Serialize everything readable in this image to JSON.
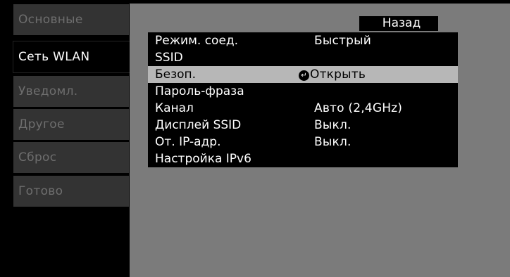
{
  "sidebar": {
    "items": [
      {
        "label": "Основные"
      },
      {
        "label": "Сеть WLAN"
      },
      {
        "label": "Уведомл."
      },
      {
        "label": "Другое"
      },
      {
        "label": "Сброс"
      },
      {
        "label": "Готово"
      }
    ],
    "active_index": 1
  },
  "panel": {
    "back_label": "Назад",
    "rows": [
      {
        "label": "Режим. соед.",
        "value": "Быстрый"
      },
      {
        "label": "SSID",
        "value": ""
      },
      {
        "label": "Безоп.",
        "value": "Открыть",
        "icon": "enter-arrow-icon",
        "selected": true
      },
      {
        "label": "Пароль-фраза",
        "value": ""
      },
      {
        "label": "Канал",
        "value": "Авто (2,4GHz)"
      },
      {
        "label": "Дисплей SSID",
        "value": "Выкл."
      },
      {
        "label": "От. IP-адр.",
        "value": "Выкл."
      },
      {
        "label": "Настройка IPv6",
        "value": ""
      }
    ]
  },
  "colors": {
    "sidebar_inactive_bg": "#333333",
    "sidebar_inactive_text": "#6e6e6e",
    "panel_bg": "#7b7b7b",
    "selected_row_bg": "#b7b7b7"
  }
}
